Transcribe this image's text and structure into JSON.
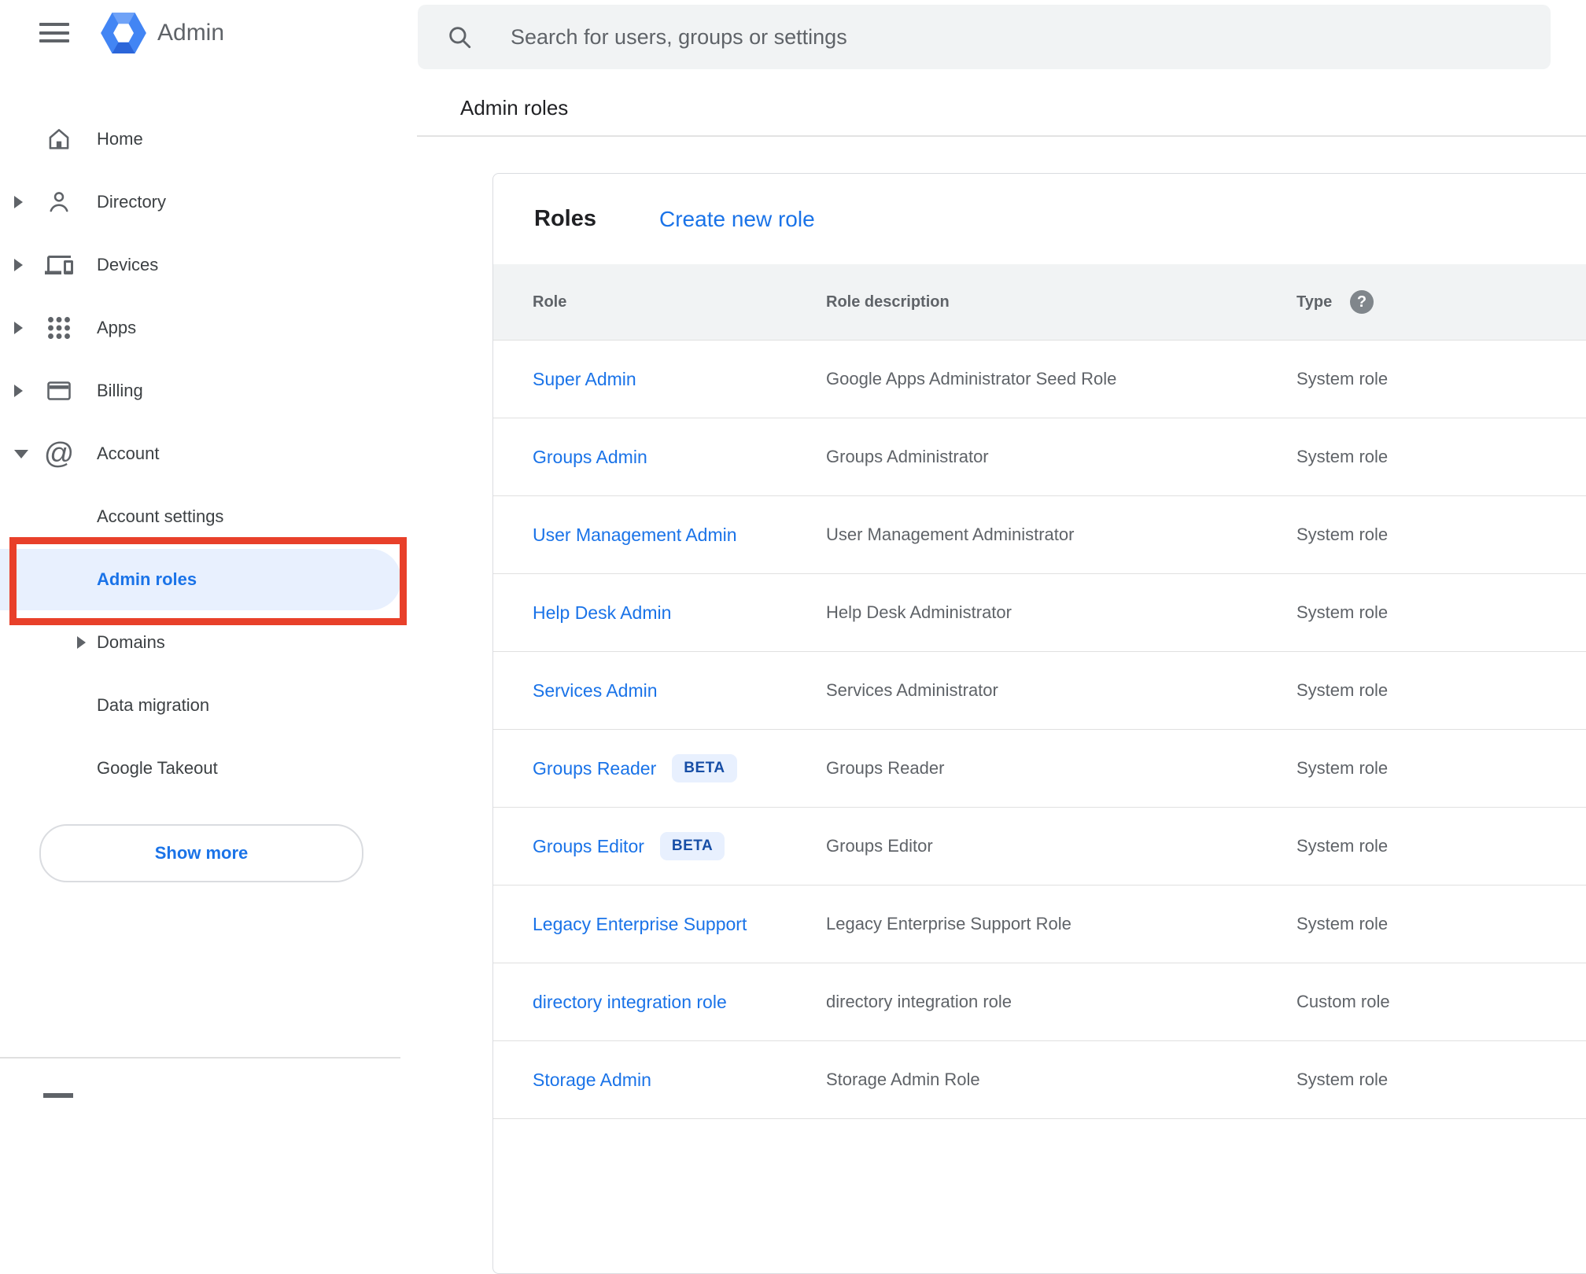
{
  "app": {
    "name": "Admin"
  },
  "search": {
    "placeholder": "Search for users, groups or settings"
  },
  "page": {
    "title": "Admin roles"
  },
  "sidebar": {
    "items": [
      {
        "label": "Home",
        "icon": "home",
        "arrow": null,
        "indent": false,
        "selected": false
      },
      {
        "label": "Directory",
        "icon": "person",
        "arrow": "right",
        "indent": false,
        "selected": false
      },
      {
        "label": "Devices",
        "icon": "devices",
        "arrow": "right",
        "indent": false,
        "selected": false
      },
      {
        "label": "Apps",
        "icon": "apps",
        "arrow": "right",
        "indent": false,
        "selected": false
      },
      {
        "label": "Billing",
        "icon": "credit-card",
        "arrow": "right",
        "indent": false,
        "selected": false
      },
      {
        "label": "Account",
        "icon": "at-sign",
        "arrow": "down",
        "indent": false,
        "selected": false
      },
      {
        "label": "Account settings",
        "icon": null,
        "arrow": null,
        "indent": true,
        "selected": false
      },
      {
        "label": "Admin roles",
        "icon": null,
        "arrow": null,
        "indent": true,
        "selected": true
      },
      {
        "label": "Domains",
        "icon": null,
        "arrow": "right",
        "indent": true,
        "selected": false
      },
      {
        "label": "Data migration",
        "icon": null,
        "arrow": null,
        "indent": true,
        "selected": false
      },
      {
        "label": "Google Takeout",
        "icon": null,
        "arrow": null,
        "indent": true,
        "selected": false
      }
    ],
    "show_more_label": "Show more"
  },
  "main": {
    "card_title": "Roles",
    "create_link_label": "Create new role",
    "table": {
      "columns": [
        "Role",
        "Role description",
        "Type"
      ],
      "type_help_glyph": "?",
      "beta_label": "BETA",
      "rows": [
        {
          "role": "Super Admin",
          "beta": false,
          "description": "Google Apps Administrator Seed Role",
          "type": "System role"
        },
        {
          "role": "Groups Admin",
          "beta": false,
          "description": "Groups Administrator",
          "type": "System role"
        },
        {
          "role": "User Management Admin",
          "beta": false,
          "description": "User Management Administrator",
          "type": "System role"
        },
        {
          "role": "Help Desk Admin",
          "beta": false,
          "description": "Help Desk Administrator",
          "type": "System role"
        },
        {
          "role": "Services Admin",
          "beta": false,
          "description": "Services Administrator",
          "type": "System role"
        },
        {
          "role": "Groups Reader",
          "beta": true,
          "description": "Groups Reader",
          "type": "System role"
        },
        {
          "role": "Groups Editor",
          "beta": true,
          "description": "Groups Editor",
          "type": "System role"
        },
        {
          "role": "Legacy Enterprise Support",
          "beta": false,
          "description": "Legacy Enterprise Support Role",
          "type": "System role"
        },
        {
          "role": "directory integration role",
          "beta": false,
          "description": "directory integration role",
          "type": "Custom role"
        },
        {
          "role": "Storage Admin",
          "beta": false,
          "description": "Storage Admin Role",
          "type": "System role"
        }
      ]
    }
  },
  "colors": {
    "accent_blue": "#1a73e8",
    "selected_pill_bg": "#e8f0fe",
    "annotation_red": "#e8402a",
    "table_header_bg": "#f1f3f4",
    "divider": "#e0e0e0",
    "text_primary": "#202124",
    "text_secondary": "#5f6368",
    "beta_text": "#174ea6",
    "card_border": "#dadce0"
  }
}
